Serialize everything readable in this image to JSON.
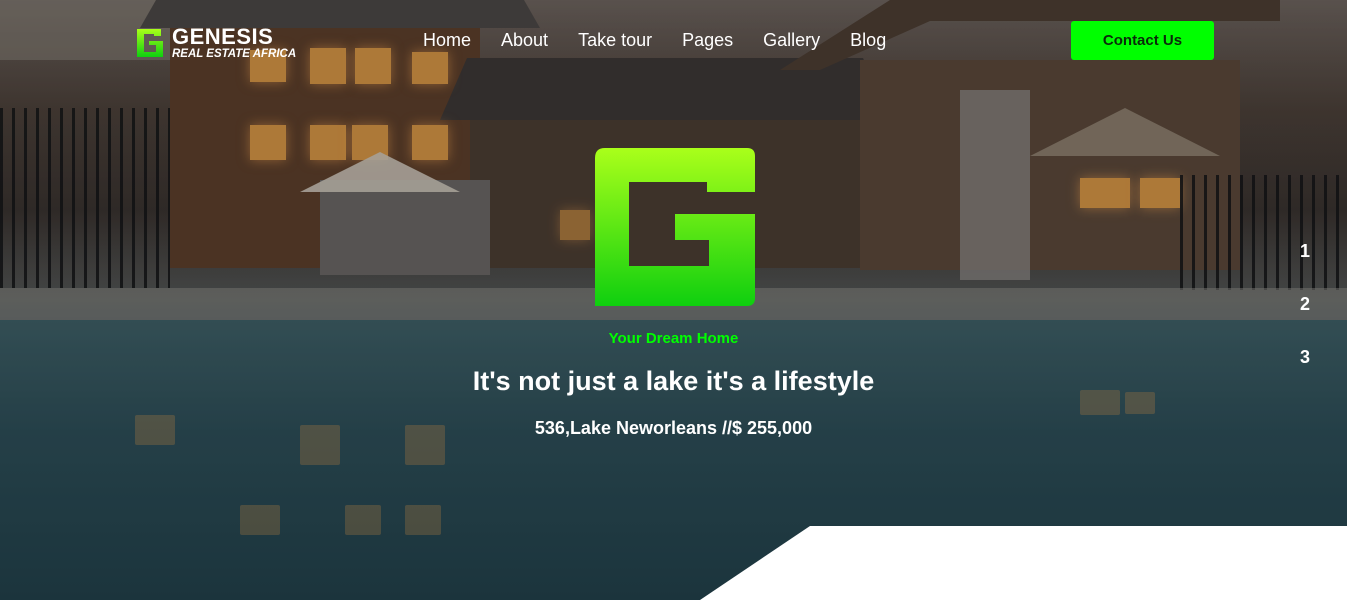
{
  "header": {
    "brand_name": "GENESIS",
    "brand_sub": "REAL ESTATE AFRICA",
    "nav": [
      "Home",
      "About",
      "Take tour",
      "Pages",
      "Gallery",
      "Blog"
    ],
    "contact_label": "Contact Us"
  },
  "hero": {
    "tagline": "Your Dream Home",
    "headline": "It's not just a lake it's a lifestyle",
    "subline": "536,Lake Neworleans //$ 255,000",
    "logo_icon": "genesis-g-logo"
  },
  "slider": {
    "pages": [
      "1",
      "2",
      "3"
    ]
  },
  "colors": {
    "accent": "#00ff00",
    "logo_gradient_top": "#aaff1a",
    "logo_gradient_bottom": "#0fcf0f",
    "text": "#ffffff"
  }
}
